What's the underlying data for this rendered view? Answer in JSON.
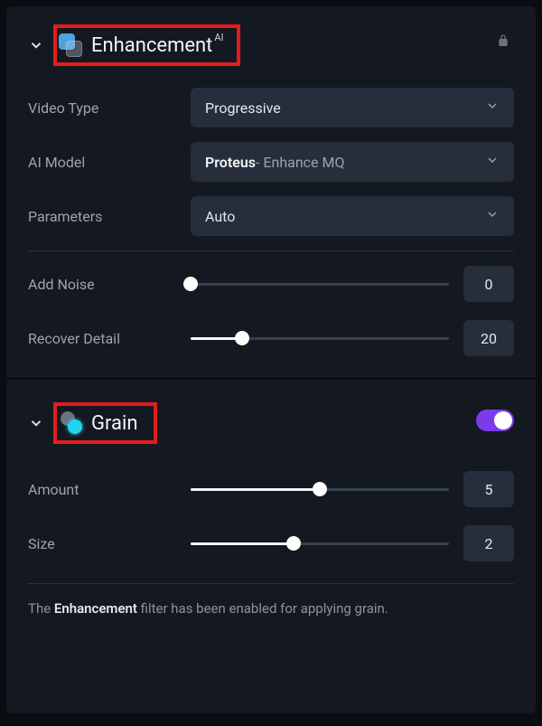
{
  "enhancement": {
    "title": "Enhancement",
    "ai_tag": "AI",
    "video_type": {
      "label": "Video Type",
      "value": "Progressive"
    },
    "ai_model": {
      "label": "AI Model",
      "main": "Proteus",
      "sub": " - Enhance MQ"
    },
    "parameters": {
      "label": "Parameters",
      "value": "Auto"
    },
    "add_noise": {
      "label": "Add Noise",
      "value": "0",
      "pct": 0
    },
    "recover": {
      "label": "Recover Detail",
      "value": "20",
      "pct": 20
    }
  },
  "grain": {
    "title": "Grain",
    "enabled": true,
    "amount": {
      "label": "Amount",
      "value": "5",
      "pct": 50
    },
    "size": {
      "label": "Size",
      "value": "2",
      "pct": 40
    }
  },
  "footer": {
    "pre": "The ",
    "bold": "Enhancement",
    "post": " filter has been enabled for applying grain."
  }
}
